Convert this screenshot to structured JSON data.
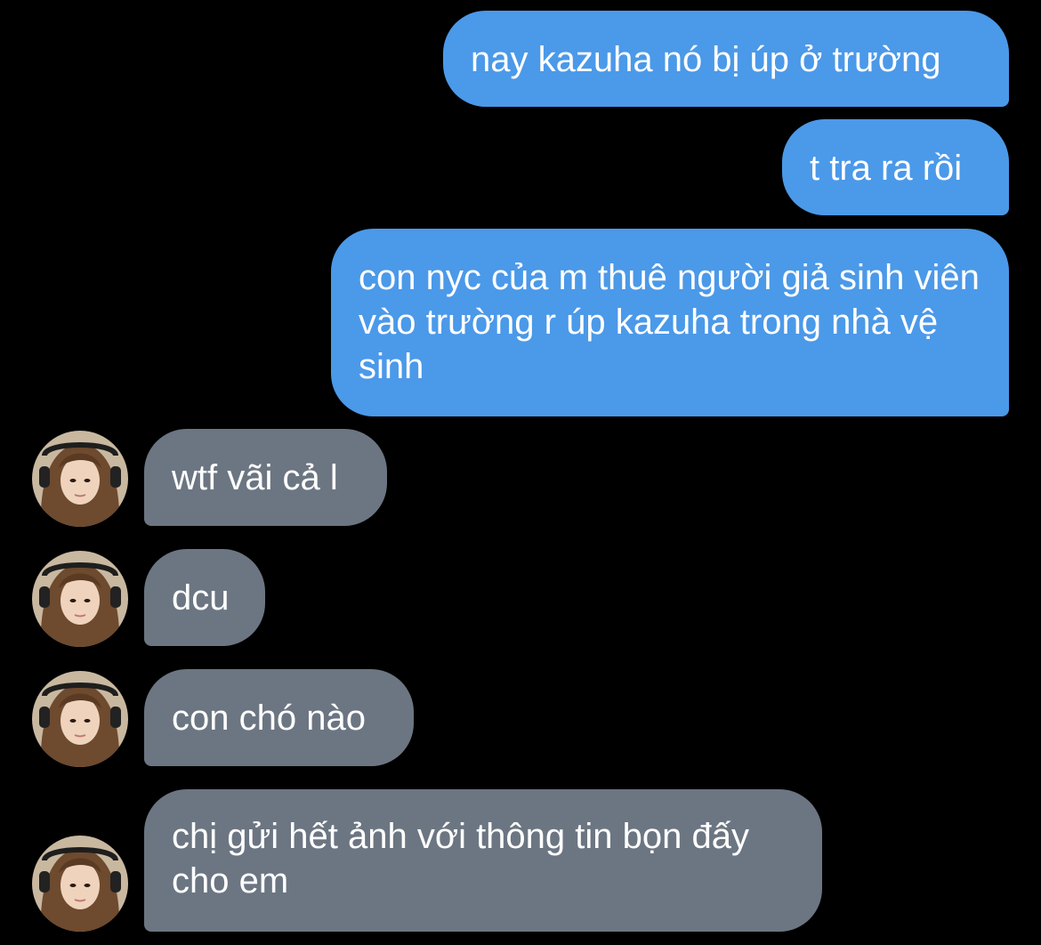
{
  "conversation": {
    "messages": [
      {
        "direction": "outgoing",
        "text": "nay kazuha nó bị úp ở trường"
      },
      {
        "direction": "outgoing",
        "text": "t tra ra rồi"
      },
      {
        "direction": "outgoing",
        "text": "con nyc của m thuê người giả sinh viên vào trường r úp kazuha trong nhà vệ sinh"
      },
      {
        "direction": "incoming",
        "text": "wtf vãi cả l",
        "avatar": "contact-avatar"
      },
      {
        "direction": "incoming",
        "text": "dcu",
        "avatar": "contact-avatar"
      },
      {
        "direction": "incoming",
        "text": "con chó nào",
        "avatar": "contact-avatar"
      },
      {
        "direction": "incoming",
        "text": "chị gửi hết ảnh với thông tin bọn đấy cho em",
        "avatar": "contact-avatar"
      }
    ]
  },
  "colors": {
    "background": "#000000",
    "outgoing_bubble": "#4b99e9",
    "incoming_bubble": "#6c7682",
    "text": "#ffffff"
  }
}
